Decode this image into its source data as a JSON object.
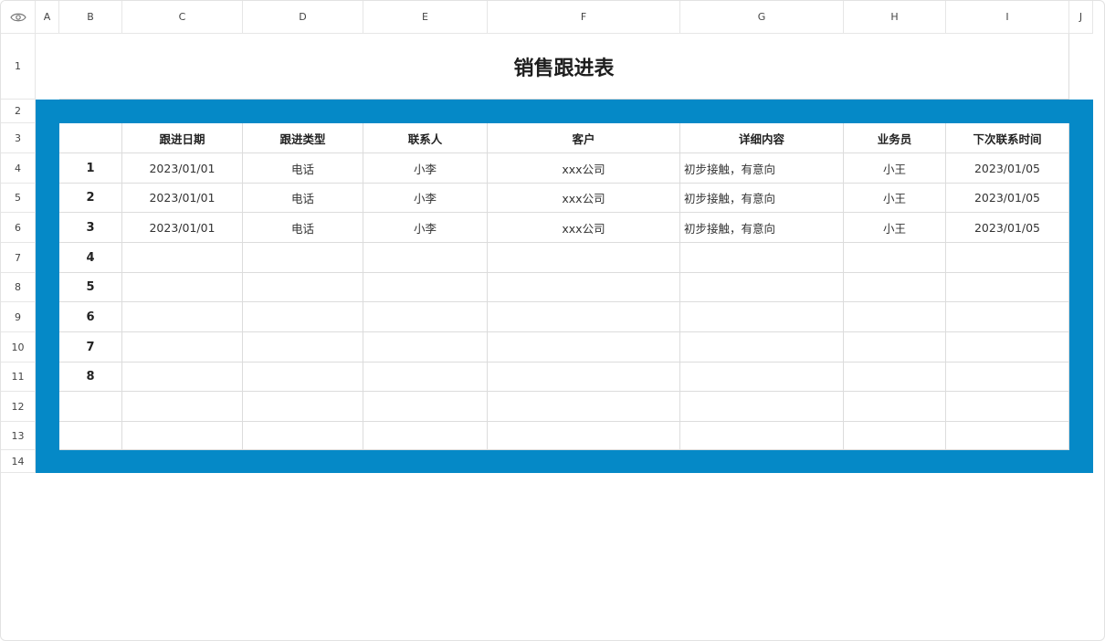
{
  "colors": {
    "band": "#0589c7",
    "grid": "#dcdcdc"
  },
  "column_headers": [
    "A",
    "B",
    "C",
    "D",
    "E",
    "F",
    "G",
    "H",
    "I",
    "J"
  ],
  "row_headers": [
    "1",
    "2",
    "3",
    "4",
    "5",
    "6",
    "7",
    "8",
    "9",
    "10",
    "11",
    "12",
    "13",
    "14"
  ],
  "corner_icon": "eye-icon",
  "sheet": {
    "title": "销售跟进表",
    "headers": [
      "",
      "跟进日期",
      "跟进类型",
      "联系人",
      "客户",
      "详细内容",
      "业务员",
      "下次联系时间"
    ],
    "rows": [
      [
        "1",
        "2023/01/01",
        "电话",
        "小李",
        "xxx公司",
        "初步接触，有意向",
        "小王",
        "2023/01/05"
      ],
      [
        "2",
        "2023/01/01",
        "电话",
        "小李",
        "xxx公司",
        "初步接触，有意向",
        "小王",
        "2023/01/05"
      ],
      [
        "3",
        "2023/01/01",
        "电话",
        "小李",
        "xxx公司",
        "初步接触，有意向",
        "小王",
        "2023/01/05"
      ],
      [
        "4",
        "",
        "",
        "",
        "",
        "",
        "",
        ""
      ],
      [
        "5",
        "",
        "",
        "",
        "",
        "",
        "",
        ""
      ],
      [
        "6",
        "",
        "",
        "",
        "",
        "",
        "",
        ""
      ],
      [
        "7",
        "",
        "",
        "",
        "",
        "",
        "",
        ""
      ],
      [
        "8",
        "",
        "",
        "",
        "",
        "",
        "",
        ""
      ],
      [
        "",
        "",
        "",
        "",
        "",
        "",
        "",
        ""
      ],
      [
        "",
        "",
        "",
        "",
        "",
        "",
        "",
        ""
      ]
    ]
  }
}
